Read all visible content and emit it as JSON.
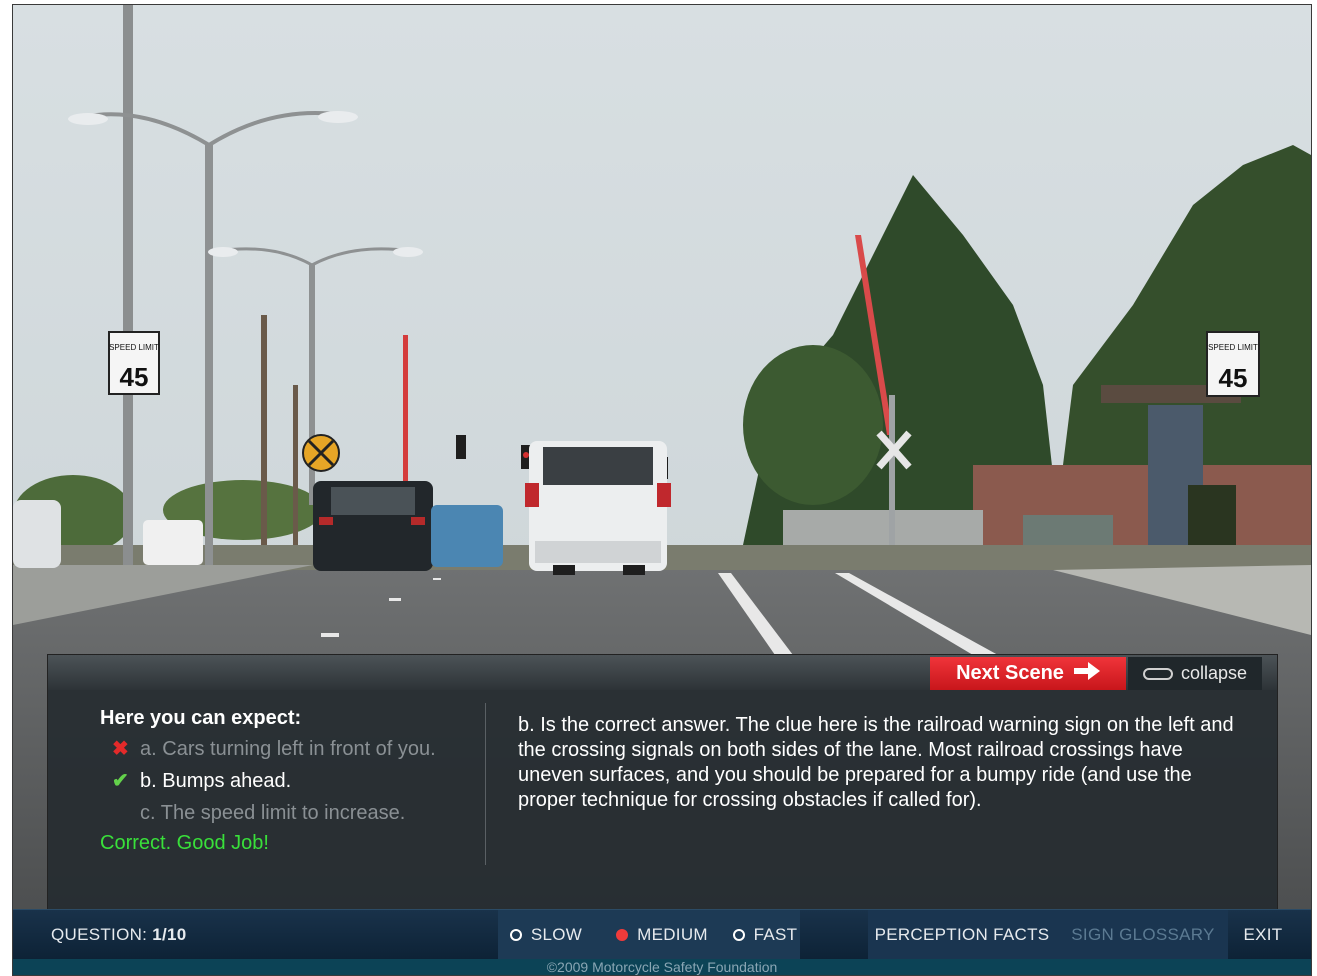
{
  "panel": {
    "next_scene_label": "Next Scene",
    "collapse_label": "collapse",
    "expect_title": "Here you can expect:",
    "options": [
      {
        "letter": "a.",
        "text": "Cars turning left in front of you.",
        "mark": "✖"
      },
      {
        "letter": "b.",
        "text": "Bumps ahead.",
        "mark": "✔"
      },
      {
        "letter": "c.",
        "text": "The speed limit to increase.",
        "mark": ""
      }
    ],
    "result": "Correct. Good Job!",
    "answer": "b. Is the correct answer.  The clue here is the railroad warning sign on the left and the crossing signals on both sides of the lane.  Most railroad crossings have uneven surfaces, and you should be prepared for a bumpy ride (and use the proper technique for crossing obstacles if called for)."
  },
  "signs": {
    "speed_limit_text": "SPEED LIMIT",
    "speed_limit_value": "45"
  },
  "navbar": {
    "question_label": "QUESTION:",
    "question_value": "1/10",
    "speed_options": [
      "SLOW",
      "MEDIUM",
      "FAST"
    ],
    "selected_speed": "MEDIUM",
    "perception_facts": "PERCEPTION FACTS",
    "sign_glossary": "SIGN GLOSSARY",
    "exit": "EXIT"
  },
  "footer": {
    "copyright": "©2009 Motorcycle Safety Foundation"
  },
  "colors": {
    "next_scene": "#e0222a",
    "correct": "#39e03a",
    "wrong_mark": "#e32a2a",
    "check_mark": "#63d14b",
    "navbar": "#0d2236"
  }
}
